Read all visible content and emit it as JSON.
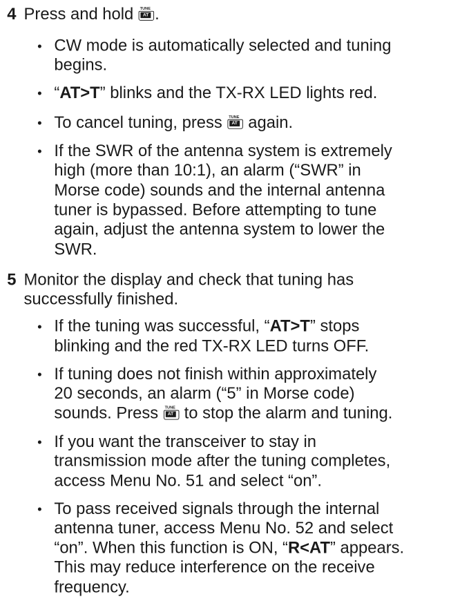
{
  "key_icon": {
    "top": "TUNE",
    "label": "AT"
  },
  "step4": {
    "number": "4",
    "text_before": "Press and hold ",
    "text_after": ".",
    "bullets": [
      {
        "lines": [
          "CW mode is automatically selected and tuning",
          "begins."
        ]
      },
      {
        "q1": "“",
        "bold": "AT>T",
        "rest": "” blinks and the TX-RX LED lights red."
      },
      {
        "before": "To cancel tuning, press ",
        "after": " again."
      },
      {
        "lines": [
          "If the SWR of the antenna system is extremely",
          "high (more than 10:1), an alarm (“SWR” in",
          "Morse code) sounds and the internal antenna",
          "tuner is bypassed.  Before attempting to tune",
          "again, adjust the antenna system to lower the",
          "SWR."
        ]
      }
    ]
  },
  "step5": {
    "number": "5",
    "lines": [
      "Monitor the display and check that tuning has",
      "successfully finished."
    ],
    "bullets": [
      {
        "l1_before": "If the tuning was successful, “",
        "l1_bold": "AT>T",
        "l1_after": "” stops",
        "l2": "blinking and the red TX-RX LED turns OFF."
      },
      {
        "l1": "If tuning does not finish within approximately",
        "l2": "20 seconds, an alarm (“5” in Morse code)",
        "l3_before": "sounds.  Press ",
        "l3_after": " to stop the alarm and tuning."
      },
      {
        "lines": [
          "If you want the transceiver to stay in",
          "transmission mode after the tuning completes,",
          "access Menu No. 51 and select “on”."
        ]
      },
      {
        "l1": "To pass received signals through the internal",
        "l2": "antenna tuner, access Menu No. 52 and select",
        "l3_before": "“on”.  When this function is ON, “",
        "l3_bold": "R<AT",
        "l3_after": "” appears.",
        "l4": "This may reduce interference on the receive",
        "l5": "frequency."
      }
    ]
  }
}
